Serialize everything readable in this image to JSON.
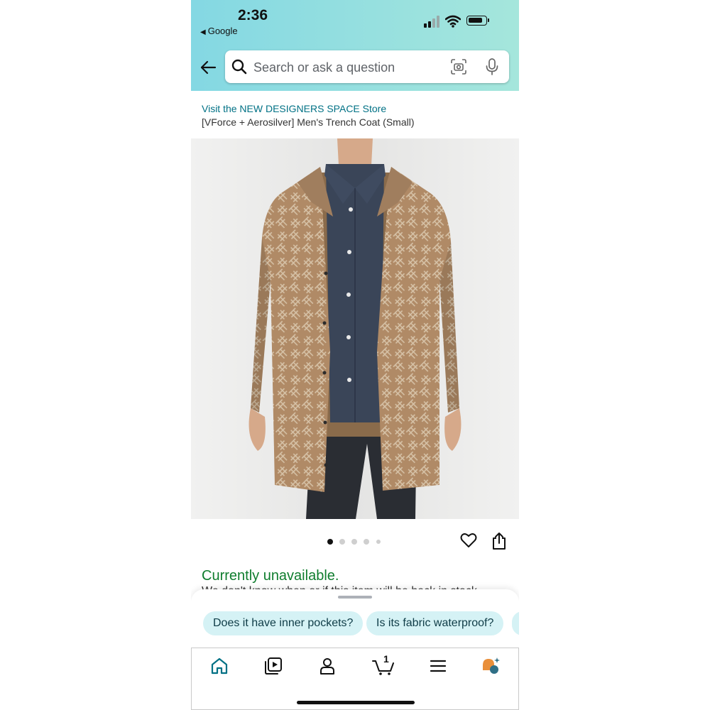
{
  "status_bar": {
    "time": "2:36",
    "back_app": "Google"
  },
  "search": {
    "placeholder": "Search or ask a question"
  },
  "product": {
    "store_link": "Visit the NEW DESIGNERS SPACE Store",
    "title": "[VForce + Aerosilver] Men's Trench Coat (Small)",
    "image_count": 5,
    "active_image": 1,
    "availability": "Currently unavailable.",
    "availability_note": "We don't know when or if this item will be back in stock."
  },
  "suggestions": [
    "Does it have inner pockets?",
    "Is its fabric waterproof?"
  ],
  "bottom_nav": {
    "items": [
      "home-icon",
      "video-icon",
      "account-icon",
      "cart-icon",
      "menu-icon",
      "rufus-icon"
    ],
    "cart_count": "1"
  },
  "colors": {
    "header_gradient_start": "#84d8e3",
    "header_gradient_end": "#a5e6dc",
    "link": "#007185",
    "availability": "#0f7d2e",
    "chip_bg": "#d5f2f5"
  }
}
